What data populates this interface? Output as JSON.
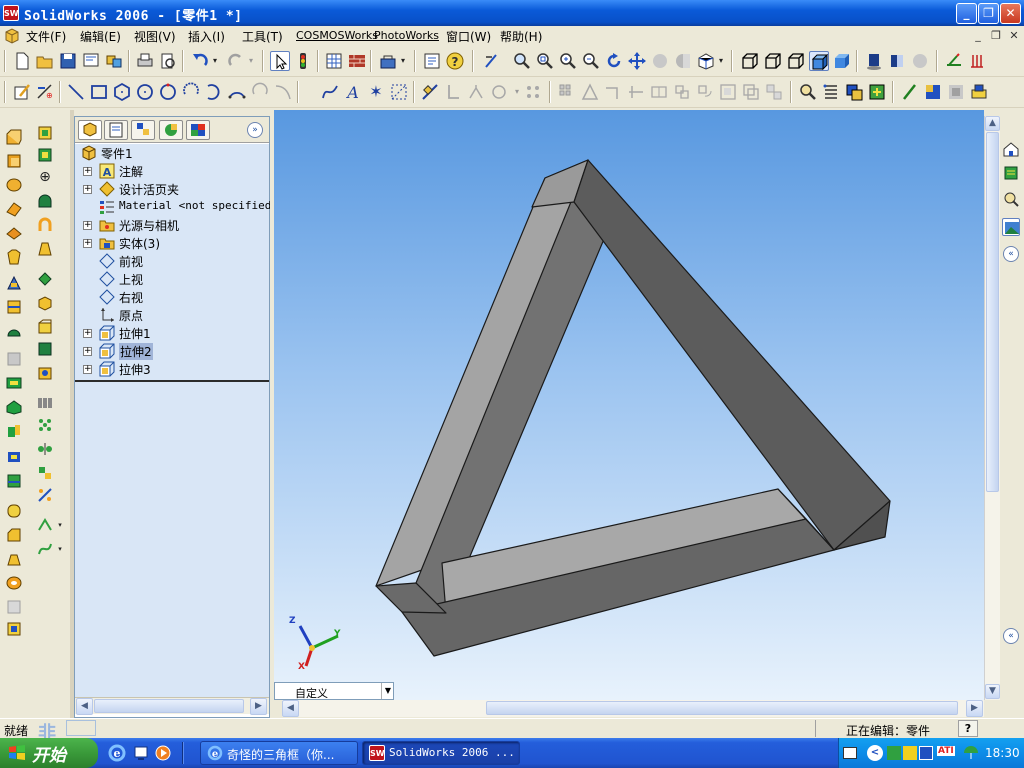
{
  "title": {
    "text": "SolidWorks 2006 - [零件1 *]",
    "app_icon": "SW"
  },
  "window_buttons": [
    "minimize",
    "maximize",
    "close"
  ],
  "menubar": {
    "items": [
      "文件(F)",
      "编辑(E)",
      "视图(V)",
      "插入(I)",
      "工具(T)",
      "COSMOSWorks",
      "PhotoWorks",
      "窗口(W)",
      "帮助(H)"
    ]
  },
  "feature_tree": {
    "root": "零件1",
    "items": [
      {
        "label": "注解",
        "expandable": true,
        "icon": "annotation-icon"
      },
      {
        "label": "设计活页夹",
        "expandable": true,
        "icon": "design-binder-icon"
      },
      {
        "label": "Material <not specified>",
        "expandable": false,
        "icon": "material-icon"
      },
      {
        "label": "光源与相机",
        "expandable": true,
        "icon": "lights-camera-icon"
      },
      {
        "label": "实体(3)",
        "expandable": true,
        "icon": "solid-bodies-icon"
      },
      {
        "label": "前视",
        "expandable": false,
        "icon": "plane-icon"
      },
      {
        "label": "上视",
        "expandable": false,
        "icon": "plane-icon"
      },
      {
        "label": "右视",
        "expandable": false,
        "icon": "plane-icon"
      },
      {
        "label": "原点",
        "expandable": false,
        "icon": "origin-icon"
      },
      {
        "label": "拉伸1",
        "expandable": true,
        "icon": "extrude-icon"
      },
      {
        "label": "拉伸2",
        "expandable": true,
        "icon": "extrude-icon",
        "selected": true
      },
      {
        "label": "拉伸3",
        "expandable": true,
        "icon": "extrude-icon"
      }
    ]
  },
  "view_selector": {
    "value": "自定义"
  },
  "triad": {
    "x": "X",
    "y": "Y",
    "z": "Z"
  },
  "status": {
    "left": "就绪",
    "right": "正在编辑：零件",
    "help": "?"
  },
  "watermark": "非",
  "taskbar": {
    "start_label": "开始",
    "tasks": [
      {
        "label": "奇怪的三角框（你...",
        "icon": "ie-icon"
      },
      {
        "label": "SolidWorks 2006 ...",
        "icon": "solidworks-icon"
      }
    ],
    "clock": "18:30",
    "tray_text": "ATI"
  },
  "colors": {
    "titlebar": "#0A5AD8",
    "viewport_top": "#5898E0",
    "viewport_bottom": "#E8F2FC",
    "model_light": "#A8A8A8",
    "model_mid": "#777777",
    "model_dark": "#5A5A5A"
  }
}
